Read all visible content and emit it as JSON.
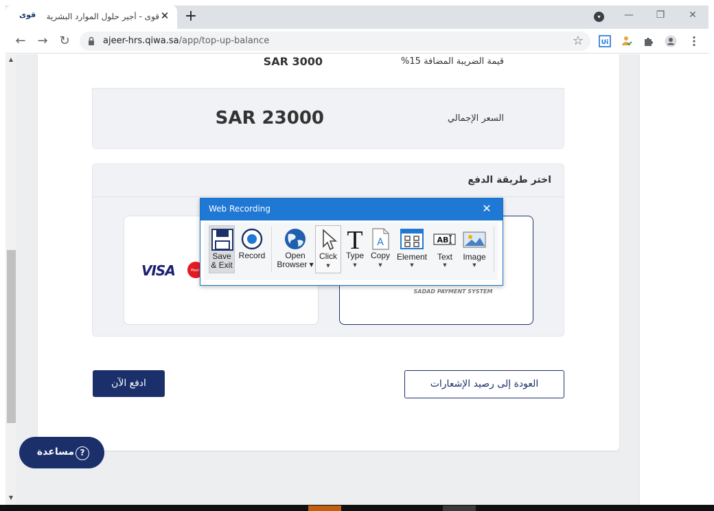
{
  "browser": {
    "tab_title": "قوى - أجير حلول الموارد البشرية",
    "tab_favicon": "قوى",
    "tab_close": "✕",
    "new_tab": "+",
    "url_host": "ajeer-hrs.qiwa.sa",
    "url_path": "/app/top-up-balance",
    "icons": [
      "back-arrow-icon",
      "forward-arrow-icon",
      "reload-icon",
      "lock-icon",
      "star-icon",
      "uipath-extension-icon",
      "person-check-extension-icon",
      "puzzle-extensions-icon",
      "profile-icon",
      "kebab-menu-icon"
    ]
  },
  "summary": {
    "vat_label": "قيمة الضريبة المضافة 15%",
    "vat_value": "SAR 3000",
    "total_label": "السعر الإجمالي",
    "total_value": "SAR 23000"
  },
  "payment": {
    "title": "اختر طريقة الدفع",
    "card_logo_text": "VISA",
    "sadad_caption": "SADAD PAYMENT SYSTEM"
  },
  "actions": {
    "pay_now": "ادفع الآن",
    "back": "العودة إلى رصيد الإشعارات",
    "help": "مساعدة"
  },
  "recorder": {
    "title": "Web Recording",
    "close": "✕",
    "tools": [
      {
        "label": "Save\n& Exit",
        "icon": "floppy-disk-icon"
      },
      {
        "label": "Record",
        "icon": "record-icon"
      },
      {
        "label": "Open\nBrowser",
        "icon": "globe-icon"
      },
      {
        "label": "Click",
        "icon": "cursor-icon"
      },
      {
        "label": "Type",
        "icon": "type-icon"
      },
      {
        "label": "Copy",
        "icon": "copy-icon"
      },
      {
        "label": "Element",
        "icon": "element-icon"
      },
      {
        "label": "Text",
        "icon": "text-icon"
      },
      {
        "label": "Image",
        "icon": "image-icon"
      }
    ],
    "tool_labels": {
      "save_line1": "Save",
      "save_line2": "& Exit",
      "record": "Record",
      "open_line1": "Open",
      "open_line2": "Browser",
      "click": "Click",
      "type": "Type",
      "copy": "Copy",
      "element": "Element",
      "text": "Text",
      "image": "Image"
    }
  },
  "colors": {
    "brand_navy": "#1b2f6b",
    "recorder_blue": "#1e78d4",
    "page_bg": "#eceeef",
    "panel_bg": "#f0f2f5"
  }
}
